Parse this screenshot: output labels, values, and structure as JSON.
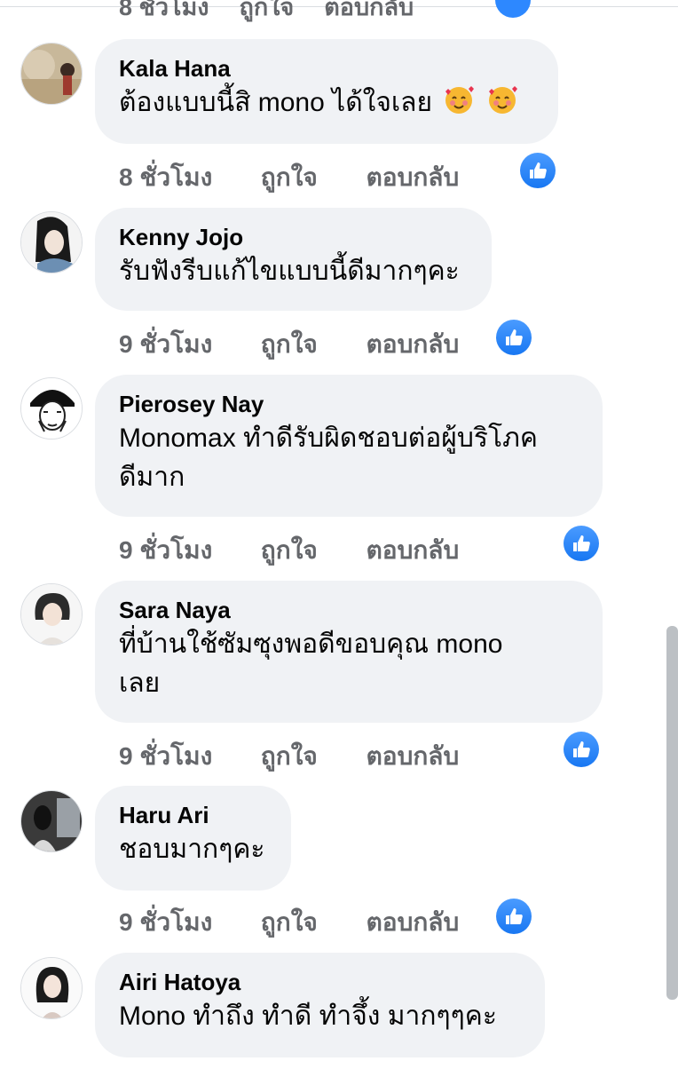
{
  "comments": [
    {
      "name": "Kala Hana",
      "text": "ต้องแบบนี้สิ mono ได้ใจเลย",
      "emojis": [
        "smiling-face-with-hearts",
        "smiling-face-with-hearts"
      ],
      "time": "8 ชั่วโมง",
      "like": "ถูกใจ",
      "reply": "ตอบกลับ"
    },
    {
      "name": "Kenny Jojo",
      "text": "รับฟังรีบแก้ไขแบบนี้ดีมากๆคะ",
      "time": "9 ชั่วโมง",
      "like": "ถูกใจ",
      "reply": "ตอบกลับ"
    },
    {
      "name": "Pierosey Nay",
      "text_lines": [
        "Monomax ทำดีรับผิดชอบต่อผู้บริโภค",
        "ดีมาก"
      ],
      "time": "9 ชั่วโมง",
      "like": "ถูกใจ",
      "reply": "ตอบกลับ"
    },
    {
      "name": "Sara Naya",
      "text_lines": [
        "ที่บ้านใช้ซัมซุงพอดีขอบคุณ mono",
        "เลย"
      ],
      "time": "9 ชั่วโมง",
      "like": "ถูกใจ",
      "reply": "ตอบกลับ"
    },
    {
      "name": "Haru Ari",
      "text": "ชอบมากๆคะ",
      "time": "9 ชั่วโมง",
      "like": "ถูกใจ",
      "reply": "ตอบกลับ"
    },
    {
      "name": "Airi Hatoya",
      "text": "Mono ทำถึง ทำดี ทำจึ้ง มากๆๆคะ"
    }
  ],
  "colors": {
    "bubble": "#f0f2f5",
    "meta": "#65676b",
    "like_badge": "#1877f2"
  }
}
